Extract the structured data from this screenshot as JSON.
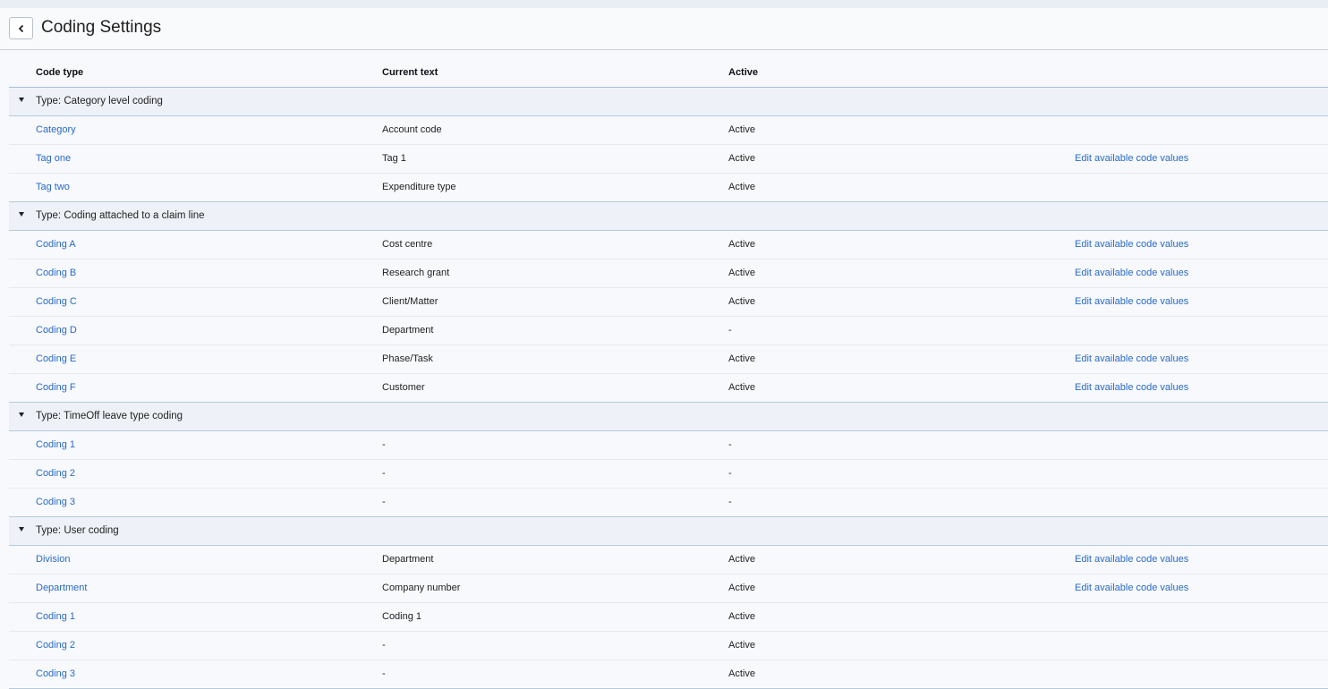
{
  "page": {
    "title": "Coding Settings",
    "back_icon": "chevron-left-icon"
  },
  "table": {
    "headers": [
      "Code type",
      "Current text",
      "Active"
    ],
    "groups": [
      {
        "label": "Type: Category level coding",
        "rows": [
          {
            "code": "Category",
            "text": "Account code",
            "active": "Active",
            "action": ""
          },
          {
            "code": "Tag one",
            "text": "Tag 1",
            "active": "Active",
            "action": "Edit available code values"
          },
          {
            "code": "Tag two",
            "text": "Expenditure type",
            "active": "Active",
            "action": ""
          }
        ]
      },
      {
        "label": "Type: Coding attached to a claim line",
        "rows": [
          {
            "code": "Coding A",
            "text": "Cost centre",
            "active": "Active",
            "action": "Edit available code values"
          },
          {
            "code": "Coding B",
            "text": "Research grant",
            "active": "Active",
            "action": "Edit available code values"
          },
          {
            "code": "Coding C",
            "text": "Client/Matter",
            "active": "Active",
            "action": "Edit available code values"
          },
          {
            "code": "Coding D",
            "text": "Department",
            "active": "-",
            "action": ""
          },
          {
            "code": "Coding E",
            "text": "Phase/Task",
            "active": "Active",
            "action": "Edit available code values"
          },
          {
            "code": "Coding F",
            "text": "Customer",
            "active": "Active",
            "action": "Edit available code values"
          }
        ]
      },
      {
        "label": "Type: TimeOff leave type coding",
        "rows": [
          {
            "code": "Coding 1",
            "text": "-",
            "active": "-",
            "action": ""
          },
          {
            "code": "Coding 2",
            "text": "-",
            "active": "-",
            "action": ""
          },
          {
            "code": "Coding 3",
            "text": "-",
            "active": "-",
            "action": ""
          }
        ]
      },
      {
        "label": "Type: User coding",
        "rows": [
          {
            "code": "Division",
            "text": "Department",
            "active": "Active",
            "action": "Edit available code values"
          },
          {
            "code": "Department",
            "text": "Company number",
            "active": "Active",
            "action": "Edit available code values"
          },
          {
            "code": "Coding 1",
            "text": "Coding 1",
            "active": "Active",
            "action": ""
          },
          {
            "code": "Coding 2",
            "text": "-",
            "active": "Active",
            "action": ""
          },
          {
            "code": "Coding 3",
            "text": "-",
            "active": "Active",
            "action": ""
          }
        ]
      }
    ]
  },
  "colors": {
    "link": "#2a6ac8",
    "group_bg": "#eef2f8",
    "divider": "#b6cadb"
  }
}
